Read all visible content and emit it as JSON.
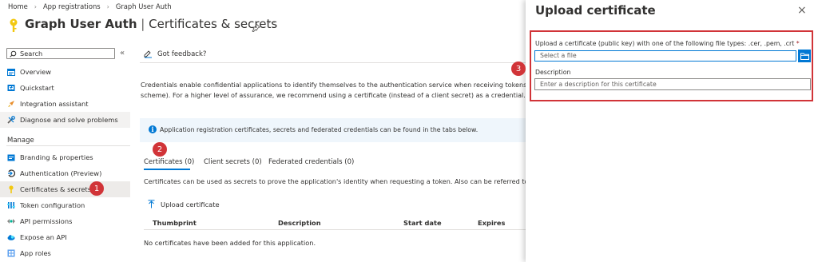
{
  "breadcrumb": [
    "Home",
    "App registrations",
    "Graph User Auth"
  ],
  "header": {
    "title_bold": "Graph User Auth",
    "divider": "|",
    "title_rest": "Certificates & secrets",
    "more": "···"
  },
  "sidebar": {
    "search_placeholder": "Search",
    "collapse": "«",
    "top_items": [
      {
        "label": "Overview",
        "icon": "overview-icon"
      },
      {
        "label": "Quickstart",
        "icon": "quickstart-icon"
      },
      {
        "label": "Integration assistant",
        "icon": "rocket-icon"
      },
      {
        "label": "Diagnose and solve problems",
        "icon": "wrench-icon"
      }
    ],
    "section_label": "Manage",
    "manage_items": [
      {
        "label": "Branding & properties",
        "icon": "branding-icon"
      },
      {
        "label": "Authentication (Preview)",
        "icon": "authentication-icon"
      },
      {
        "label": "Certificates & secrets",
        "icon": "key-icon"
      },
      {
        "label": "Token configuration",
        "icon": "token-icon"
      },
      {
        "label": "API permissions",
        "icon": "permissions-icon"
      },
      {
        "label": "Expose an API",
        "icon": "cloud-icon"
      },
      {
        "label": "App roles",
        "icon": "app-roles-icon"
      }
    ]
  },
  "main": {
    "feedback": "Got feedback?",
    "description": [
      "Credentials enable confidential applications to identify themselves to the authentication service when receiving tokens at a web addre",
      "scheme). For a higher level of assurance, we recommend using a certificate (instead of a client secret) as a credential."
    ],
    "info": "Application registration certificates, secrets and federated credentials can be found in the tabs below.",
    "tabs": [
      "Certificates (0)",
      "Client secrets (0)",
      "Federated credentials (0)"
    ],
    "cert_description": "Certificates can be used as secrets to prove the application's identity when requesting a token. Also can be referred to as public keys",
    "upload_button": "Upload certificate",
    "table_headers": [
      "Thumbprint",
      "Description",
      "Start date",
      "Expires"
    ],
    "empty_message": "No certificates have been added for this application."
  },
  "panel": {
    "title": "Upload certificate",
    "close": "×",
    "file_label": "Upload a certificate (public key) with one of the following file types: .cer, .pem, .crt",
    "required_mark": "*",
    "file_placeholder": "Select a file",
    "description_label": "Description",
    "description_placeholder": "Enter a description for this certificate"
  },
  "annotations": [
    "1",
    "2",
    "3"
  ],
  "colors": {
    "accent": "#0078d4",
    "annotation": "#d13438",
    "key_yellow": "#f2c811"
  }
}
